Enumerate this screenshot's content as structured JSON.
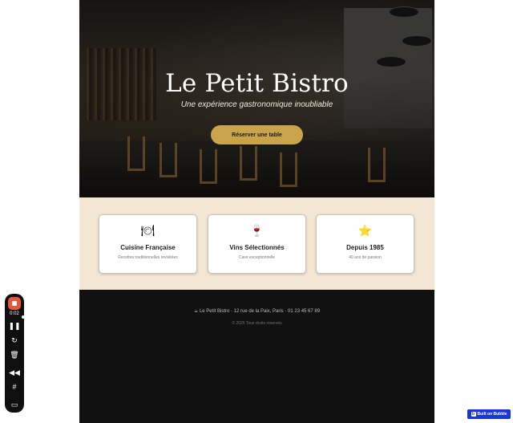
{
  "hero": {
    "title": "Le Petit Bistro",
    "subtitle": "Une expérience gastronomique inoubliable",
    "cta_label": "Réserver une table"
  },
  "features": [
    {
      "icon": "plate-cutlery-icon",
      "glyph": "🍽",
      "title": "Cuisine Française",
      "desc": "Recettes traditionnelles revisitées"
    },
    {
      "icon": "wine-glass-icon",
      "glyph": "🍷",
      "title": "Vins Sélectionnés",
      "desc": "Cave exceptionnelle"
    },
    {
      "icon": "star-icon",
      "glyph": "⭐",
      "title": "Depuis 1985",
      "desc": "40 ans de passion"
    }
  ],
  "footer": {
    "address": "☕ Le Petit Bistro · 12 rue de la Paix, Paris · 01 23 45 67 89",
    "copyright": "© 2025 Tous droits réservés"
  },
  "recorder": {
    "time": "0:02",
    "buttons": [
      "pause-icon",
      "restart-icon",
      "trash-icon",
      "rewind-icon",
      "grid-icon",
      "camera-icon"
    ]
  },
  "badge": {
    "label": "Built on Bubble",
    "logo": "b"
  },
  "colors": {
    "accent": "#c9a44a",
    "feature_bg": "#f3e6d3",
    "footer_bg": "#111111",
    "badge": "#1a37d6",
    "record": "#e8563c"
  }
}
